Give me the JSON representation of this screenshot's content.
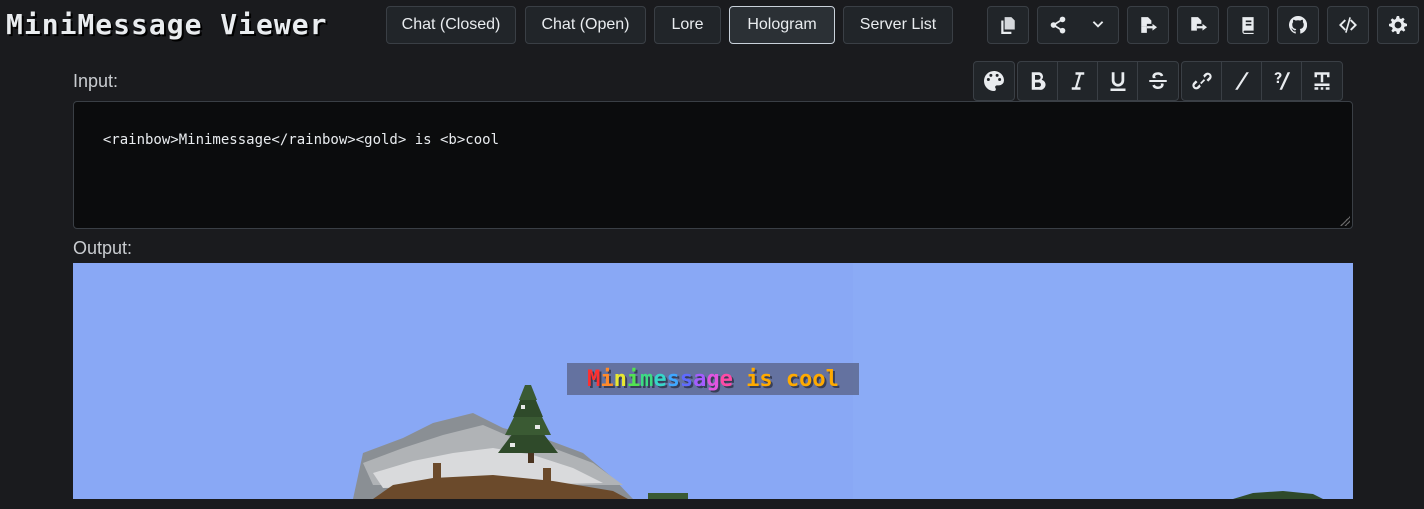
{
  "app": {
    "title": "MiniMessage Viewer"
  },
  "modes": [
    {
      "label": "Chat (Closed)",
      "active": false
    },
    {
      "label": "Chat (Open)",
      "active": false
    },
    {
      "label": "Lore",
      "active": false
    },
    {
      "label": "Hologram",
      "active": true
    },
    {
      "label": "Server List",
      "active": false
    }
  ],
  "toolbar_icons": [
    "copy-icon",
    "share-icon",
    "chevron-down-icon",
    "import-icon",
    "export-icon",
    "book-icon",
    "github-icon",
    "code-icon",
    "gear-icon"
  ],
  "input": {
    "label": "Input:",
    "value": "<rainbow>Minimessage</rainbow><gold> is <b>cool"
  },
  "format_buttons": [
    "palette-icon",
    "bold-icon",
    "italic-icon",
    "underline-icon",
    "strikethrough-icon",
    "link-icon",
    "slash-icon",
    "question-slash-icon",
    "obfuscated-icon"
  ],
  "output": {
    "label": "Output:",
    "rainbow_text": "Minimessage",
    "rainbow_colors": [
      "#ff3030",
      "#ff8a2a",
      "#e8e832",
      "#52e352",
      "#3ddc84",
      "#36d6c8",
      "#3fa7ff",
      "#5f6bff",
      "#a45cff",
      "#e055e0",
      "#ff4aa6"
    ],
    "plain_text": " is ",
    "bold_text": "cool",
    "gold_color": "#ffaa00"
  }
}
